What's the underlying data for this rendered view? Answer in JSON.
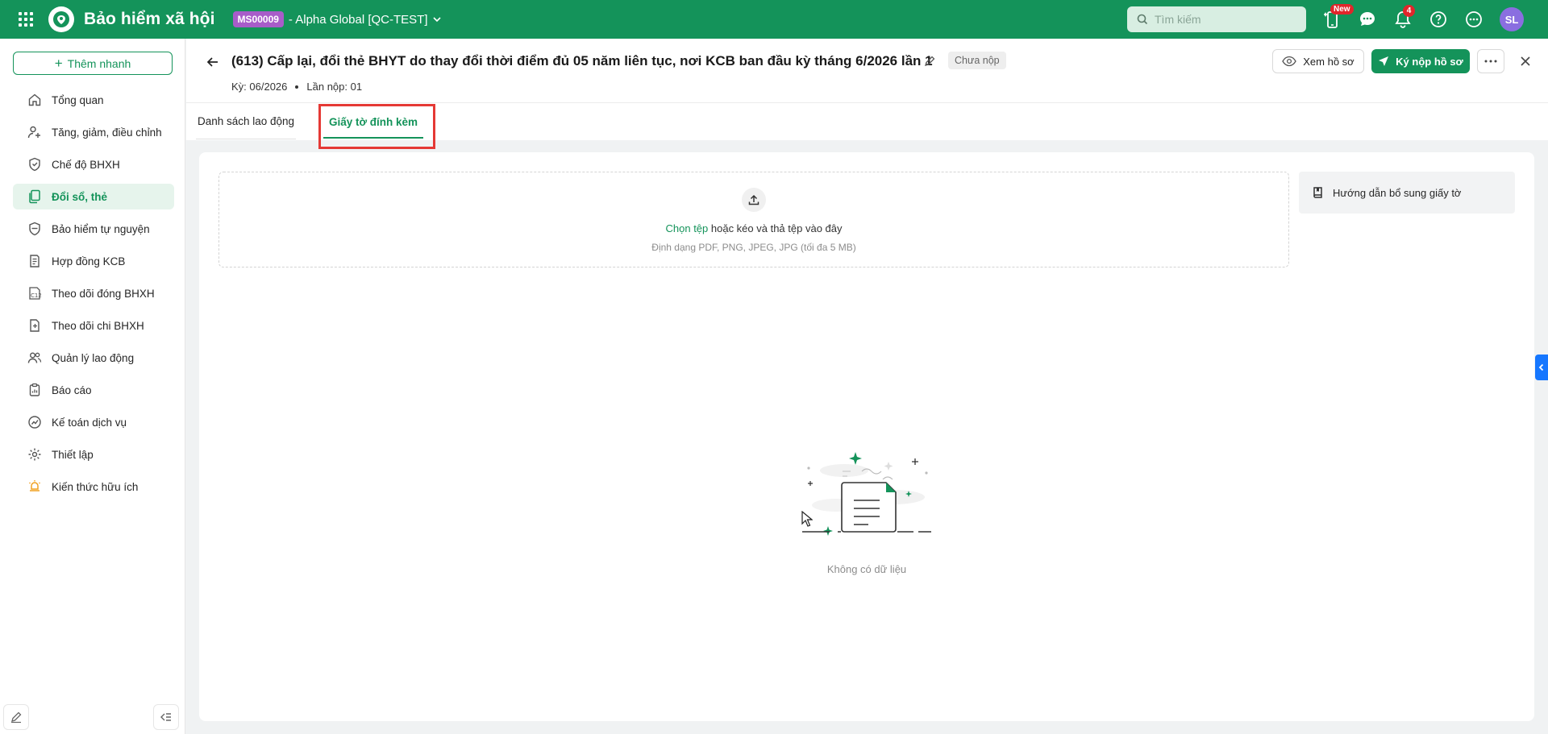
{
  "topbar": {
    "app_title": "Bảo hiểm xã hội",
    "org_code": "MS00009",
    "org_name": "- Alpha Global [QC-TEST]",
    "search_placeholder": "Tìm kiếm",
    "new_badge": "New",
    "notification_count": "4",
    "avatar_initials": "SL",
    "colors": {
      "primary": "#14935a",
      "org_badge": "#a85cc9",
      "avatar": "#8a6ee0",
      "badge": "#e0262b"
    }
  },
  "sidebar": {
    "quick_add": "Thêm nhanh",
    "items": [
      {
        "label": "Tổng quan",
        "icon": "home-icon"
      },
      {
        "label": "Tăng, giảm, điều chỉnh",
        "icon": "user-adjust-icon"
      },
      {
        "label": "Chế độ BHXH",
        "icon": "shield-heart-icon"
      },
      {
        "label": "Đổi sổ, thẻ",
        "icon": "cards-icon",
        "active": true
      },
      {
        "label": "Bảo hiểm tự nguyện",
        "icon": "shield-icon"
      },
      {
        "label": "Hợp đồng KCB",
        "icon": "contract-icon"
      },
      {
        "label": "Theo dõi đóng BHXH",
        "icon": "c12-icon"
      },
      {
        "label": "Theo dõi chi BHXH",
        "icon": "document-money-icon"
      },
      {
        "label": "Quản lý lao động",
        "icon": "users-icon"
      },
      {
        "label": "Báo cáo",
        "icon": "clipboard-icon"
      },
      {
        "label": "Kế toán dịch vụ",
        "icon": "accounting-icon"
      },
      {
        "label": "Thiết lập",
        "icon": "gear-icon"
      },
      {
        "label": "Kiến thức hữu ích",
        "icon": "lightbulb-icon"
      }
    ]
  },
  "header": {
    "title": "(613) Cấp lại, đổi thẻ BHYT do thay đổi thời điểm đủ 05 năm liên tục, nơi KCB ban đầu kỳ tháng 6/2026 lần 1",
    "status": "Chưa nộp",
    "period": "Kỳ: 06/2026",
    "submission": "Lần nộp: 01",
    "view_button": "Xem hồ sơ",
    "sign_button": "Ký nộp hồ sơ"
  },
  "tabs": [
    {
      "label": "Danh sách lao động",
      "active": false
    },
    {
      "label": "Giấy tờ đính kèm",
      "active": true
    }
  ],
  "attachments": {
    "choose_file": "Chọn tệp",
    "drop_text": " hoặc kéo và thả tệp vào đây",
    "hint": "Định dạng PDF, PNG, JPEG, JPG (tối đa 5 MB)",
    "guide": "Hướng dẫn bổ sung giấy tờ",
    "empty_text": "Không có dữ liệu"
  }
}
